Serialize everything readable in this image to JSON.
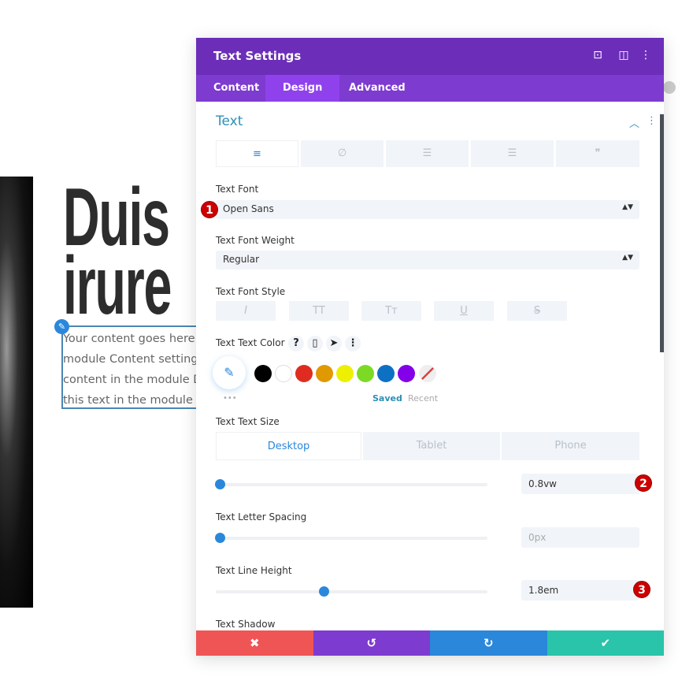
{
  "page": {
    "heading_line1": "Duis",
    "heading_line2": "irure",
    "body_lines": [
      "Your content goes here. Edit or remove this text inline or in the",
      "module Content settings. You can also style every aspect of this",
      "content in the module Design settings and even apply custom CSS to",
      "this text in the module Advanced settings."
    ]
  },
  "panel": {
    "title": "Text Settings",
    "header_icons": [
      "expand-icon",
      "split-view-icon",
      "more-icon"
    ],
    "tabs": [
      {
        "label": "Content"
      },
      {
        "label": "Design",
        "active": true
      },
      {
        "label": "Advanced"
      }
    ],
    "section_title": "Text",
    "text_tabs": [
      "align-left-icon",
      "link-icon",
      "bulleted-list-icon",
      "numbered-list-icon",
      "quote-icon"
    ],
    "font_label": "Text Font",
    "font_value": "Open Sans",
    "weight_label": "Text Font Weight",
    "weight_value": "Regular",
    "style_label": "Text Font Style",
    "style_buttons": [
      "I",
      "TT",
      "Tт",
      "U",
      "S"
    ],
    "color_label": "Text Text Color",
    "color_help": "?",
    "swatches": [
      "#000000",
      "#ffffff",
      "#e02b20",
      "#e09900",
      "#edf000",
      "#7cda24",
      "#0c71c3",
      "#8300e9"
    ],
    "saved_label": "Saved",
    "recent_label": "Recent",
    "more_label": "•••",
    "size_label": "Text Text Size",
    "devices": [
      "Desktop",
      "Tablet",
      "Phone"
    ],
    "size_value": "0.8vw",
    "size_slider": 0,
    "spacing_label": "Text Letter Spacing",
    "spacing_value": "0px",
    "spacing_slider": 0,
    "line_height_label": "Text Line Height",
    "line_height_value": "1.8em",
    "line_height_slider": 0.39,
    "shadow_label": "Text Shadow",
    "badges": [
      "1",
      "2",
      "3"
    ],
    "footer": {
      "cancel": "✖",
      "undo": "↺",
      "redo": "↻",
      "save": "✔"
    },
    "colors": {
      "header": "#6c2eb9",
      "tabs": "#7d3bcf",
      "cancel": "#ef5555",
      "undo": "#7e3bd0",
      "redo": "#2b87da",
      "save": "#29c4a9"
    }
  }
}
